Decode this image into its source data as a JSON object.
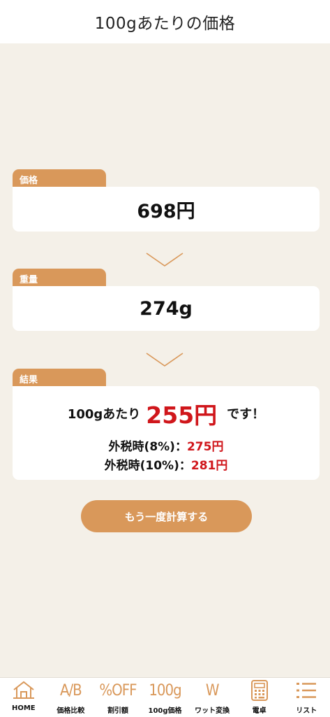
{
  "header": {
    "title": "100gあたりの価格"
  },
  "price": {
    "label": "価格",
    "value": "698円"
  },
  "weight": {
    "label": "重量",
    "value": "274g"
  },
  "result": {
    "label": "結果",
    "prefix": "100gあたり",
    "value": "255円",
    "suffix": "です！",
    "tax8_label": "外税時(8%)：",
    "tax8_value": "275円",
    "tax10_label": "外税時(10%)：",
    "tax10_value": "281円"
  },
  "again_button": {
    "label": "もう一度計算する"
  },
  "colors": {
    "accent": "#d9985a",
    "highlight": "#d0161b",
    "background": "#f4f0e8"
  },
  "nav": {
    "items": [
      {
        "icon": "home-icon",
        "icon_text": "",
        "label": "HOME"
      },
      {
        "icon": "ab-icon",
        "icon_text": "A/B",
        "label": "価格比較"
      },
      {
        "icon": "percent-off-icon",
        "icon_text": "%OFF",
        "label": "割引額"
      },
      {
        "icon": "100g-icon",
        "icon_text": "100g",
        "label": "100g価格"
      },
      {
        "icon": "watt-icon",
        "icon_text": "W",
        "label": "ワット変換"
      },
      {
        "icon": "calculator-icon",
        "icon_text": "",
        "label": "電卓"
      },
      {
        "icon": "list-icon",
        "icon_text": "",
        "label": "リスト"
      }
    ]
  }
}
